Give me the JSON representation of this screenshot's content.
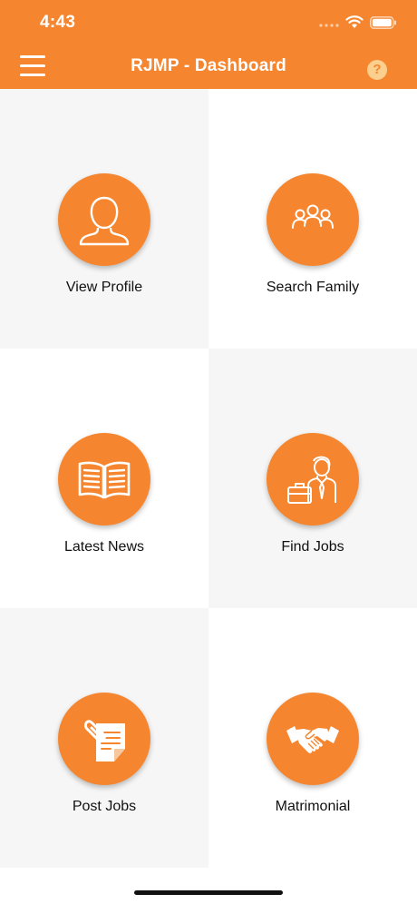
{
  "status_bar": {
    "time": "4:43"
  },
  "header": {
    "title": "RJMP - Dashboard",
    "help_label": "?"
  },
  "colors": {
    "accent": "#f5862f",
    "tile_gray": "#f6f6f6",
    "help_bg": "#fbd08e"
  },
  "dashboard": {
    "tiles": [
      {
        "label": "View Profile",
        "icon": "person-icon"
      },
      {
        "label": "Search Family",
        "icon": "group-icon"
      },
      {
        "label": "Latest News",
        "icon": "open-book-icon"
      },
      {
        "label": "Find Jobs",
        "icon": "job-seeker-icon"
      },
      {
        "label": "Post Jobs",
        "icon": "document-clip-icon"
      },
      {
        "label": "Matrimonial",
        "icon": "handshake-icon"
      }
    ]
  }
}
